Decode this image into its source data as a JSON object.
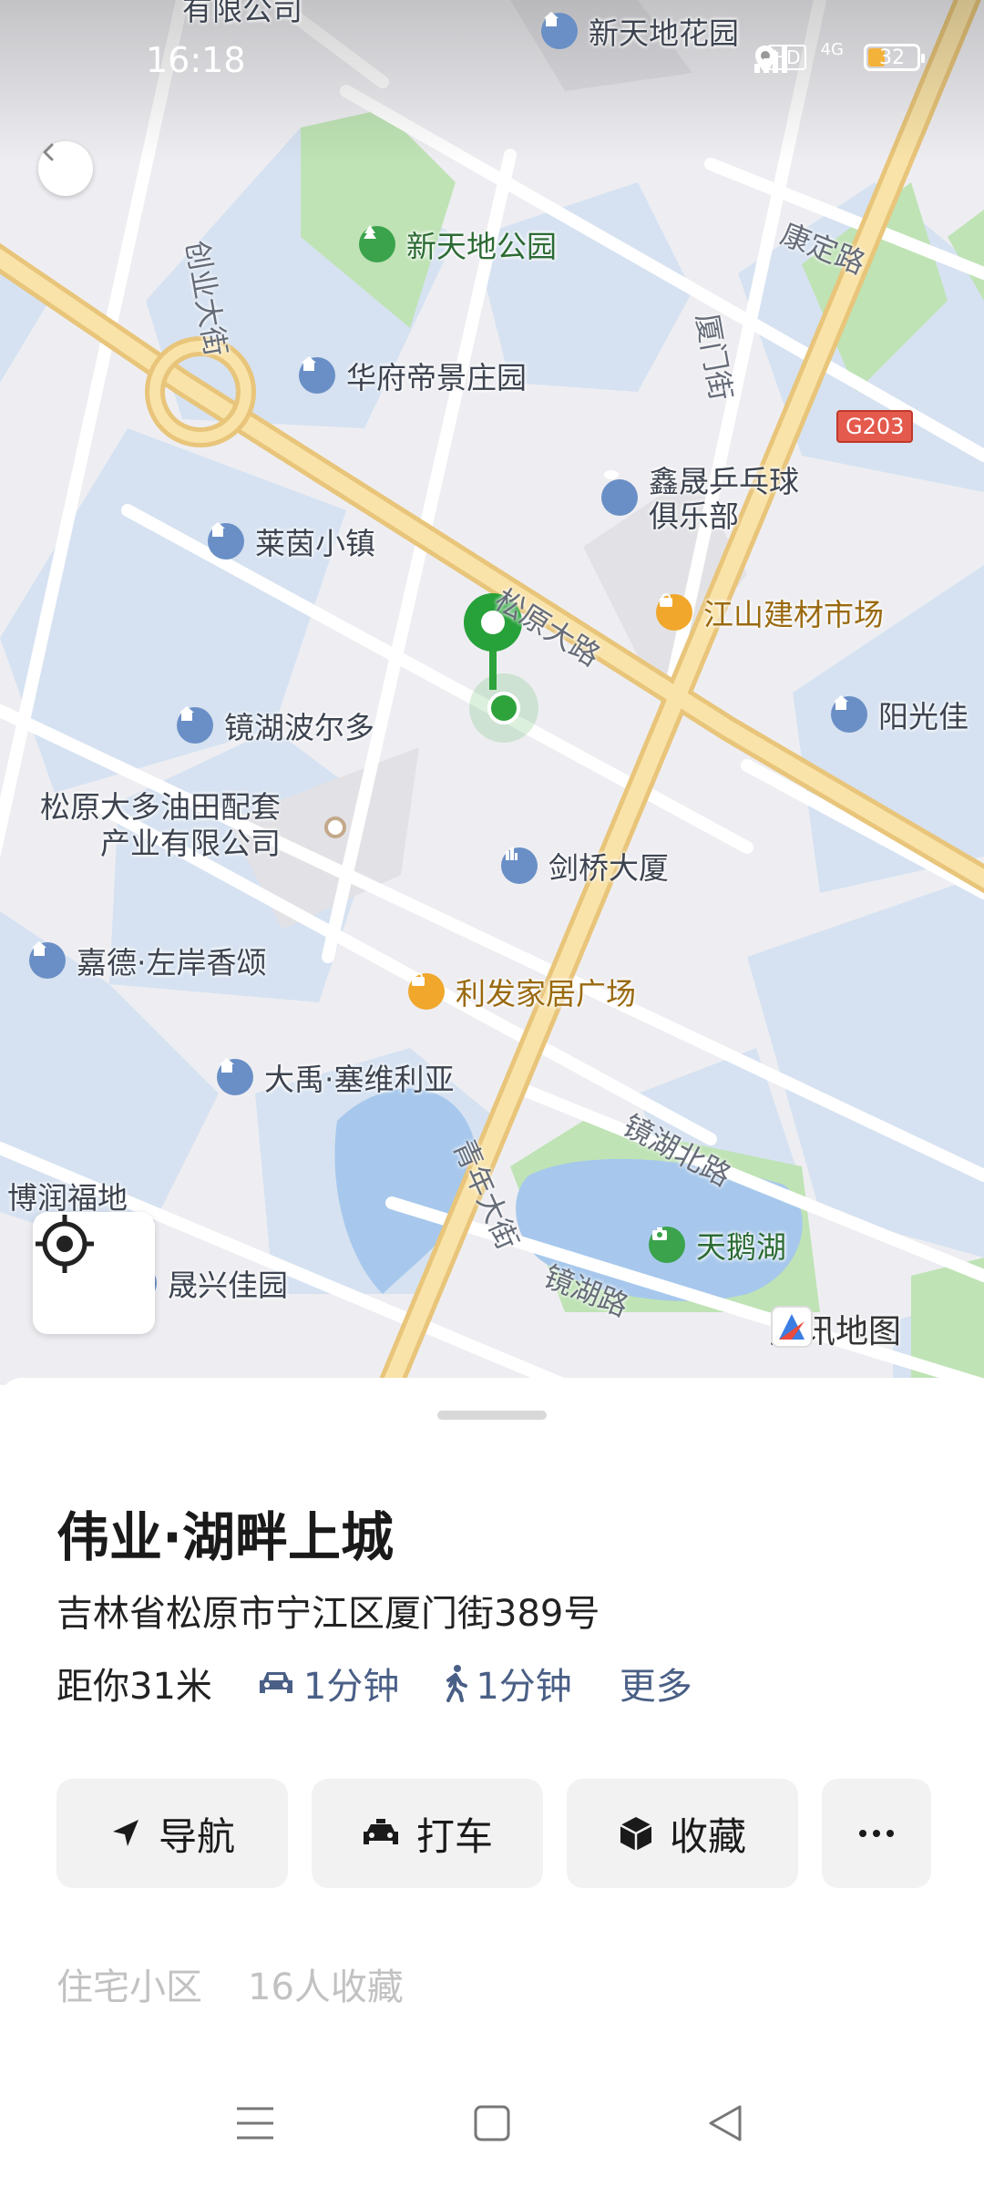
{
  "status_bar": {
    "time": "16:18",
    "hd": "HD",
    "network": "4G",
    "battery": "32"
  },
  "map": {
    "pois": [
      {
        "label": "新天地花园"
      },
      {
        "label": "新天地公园"
      },
      {
        "label": "华府帝景庄园"
      },
      {
        "label": "鑫晟乒乓球"
      },
      {
        "label": "俱乐部"
      },
      {
        "label": "莱茵小镇"
      },
      {
        "label": "江山建材市场"
      },
      {
        "label": "镜湖波尔多"
      },
      {
        "label": "阳光佳"
      },
      {
        "label": "松原大多油田配套"
      },
      {
        "label": "产业有限公司"
      },
      {
        "label": "剑桥大厦"
      },
      {
        "label": "嘉德·左岸香颂"
      },
      {
        "label": "利发家居广场"
      },
      {
        "label": "大禹·塞维利亚"
      },
      {
        "label": "天鹅湖"
      },
      {
        "label": "晟兴佳园"
      },
      {
        "label": "博润福地"
      },
      {
        "label": "有限公司"
      }
    ],
    "roads": [
      "创业大街",
      "康定路",
      "厦门街",
      "G203",
      "松原大路",
      "镜湖北路",
      "青年大街",
      "镜湖路"
    ],
    "logo": "腾讯地图"
  },
  "place": {
    "title": "伟业·湖畔上城",
    "address": "吉林省松原市宁江区厦门街389号",
    "distance": "距你31米",
    "drive_time": "1分钟",
    "walk_time": "1分钟",
    "more": "更多",
    "actions": {
      "navigate": "导航",
      "taxi": "打车",
      "favorite": "收藏"
    },
    "tags": {
      "category": "住宅小区",
      "favorites": "16人收藏"
    }
  }
}
